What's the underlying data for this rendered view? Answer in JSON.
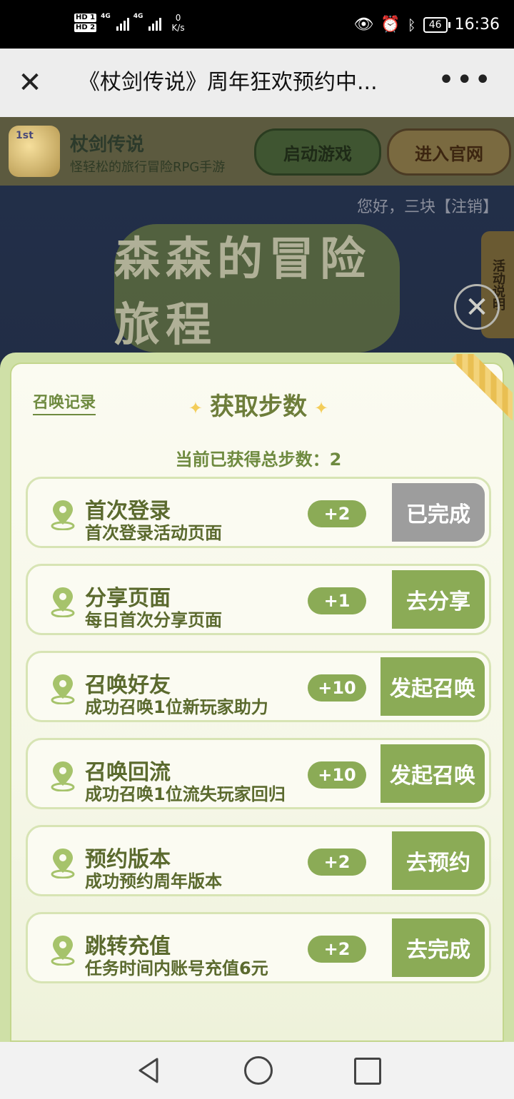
{
  "status_bar": {
    "hd1": "HD 1",
    "hd2": "HD 2",
    "signal1": "4G",
    "signal2": "4G",
    "net_speed_value": "0",
    "net_speed_unit": "K/s",
    "battery": "46",
    "time": "16:36"
  },
  "title_bar": {
    "title": "《杖剑传说》周年狂欢预约中..."
  },
  "game_header": {
    "logo_text": "1st",
    "name": "杖剑传说",
    "subtitle": "怪轻松的旅行冒险RPG手游",
    "launch_label": "启动游戏",
    "official_label": "进入官网"
  },
  "greeting": "您好，三块【注销】",
  "banner_text": "森森的冒险旅程",
  "side_tab_label": "活动说明",
  "modal": {
    "summon_record_label": "召唤记录",
    "title": "获取步数",
    "total_steps_label": "当前已获得总步数：",
    "total_steps_value": "2",
    "tasks": [
      {
        "title": "首次登录",
        "desc": "首次登录活动页面",
        "reward": "+2",
        "action": "已完成",
        "state": "done"
      },
      {
        "title": "分享页面",
        "desc": "每日首次分享页面",
        "reward": "+1",
        "action": "去分享",
        "state": "go"
      },
      {
        "title": "召唤好友",
        "desc": "成功召唤1位新玩家助力",
        "reward": "+10",
        "action": "发起召唤",
        "state": "go"
      },
      {
        "title": "召唤回流",
        "desc": "成功召唤1位流失玩家回归",
        "reward": "+10",
        "action": "发起召唤",
        "state": "go"
      },
      {
        "title": "预约版本",
        "desc": "成功预约周年版本",
        "reward": "+2",
        "action": "去预约",
        "state": "go"
      },
      {
        "title": "跳转充值",
        "desc": "任务时间内账号充值6元",
        "reward": "+2",
        "action": "去完成",
        "state": "go"
      }
    ]
  },
  "colors": {
    "accent_green": "#8bab56",
    "done_gray": "#9d9d9d",
    "text_green": "#5b6a2e"
  }
}
